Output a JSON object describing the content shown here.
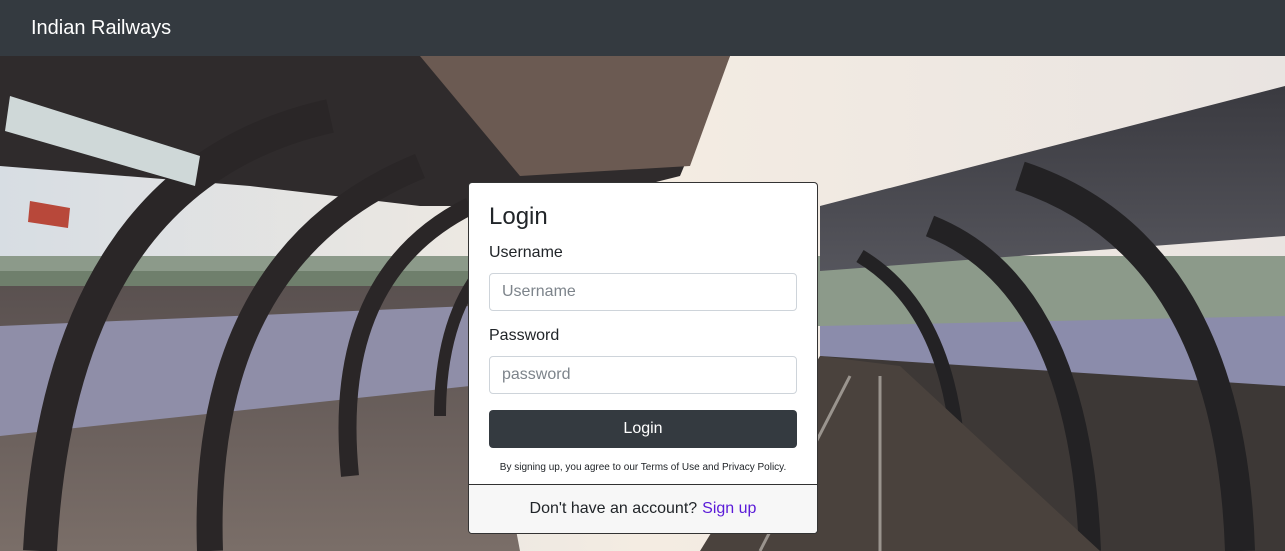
{
  "navbar": {
    "brand": "Indian Railways"
  },
  "login": {
    "title": "Login",
    "username_label": "Username",
    "username_placeholder": "Username",
    "username_value": "",
    "password_label": "Password",
    "password_placeholder": "password",
    "password_value": "",
    "submit_label": "Login",
    "terms_text": "By signing up, you agree to our Terms of Use and Privacy Policy.",
    "footer_text": "Don't have an account?",
    "signup_label": "Sign up"
  },
  "colors": {
    "navbar_bg": "#343a40",
    "button_bg": "#343a40",
    "link": "#5a1ad8"
  },
  "background": {
    "subject": "train-station-platform-photo"
  }
}
